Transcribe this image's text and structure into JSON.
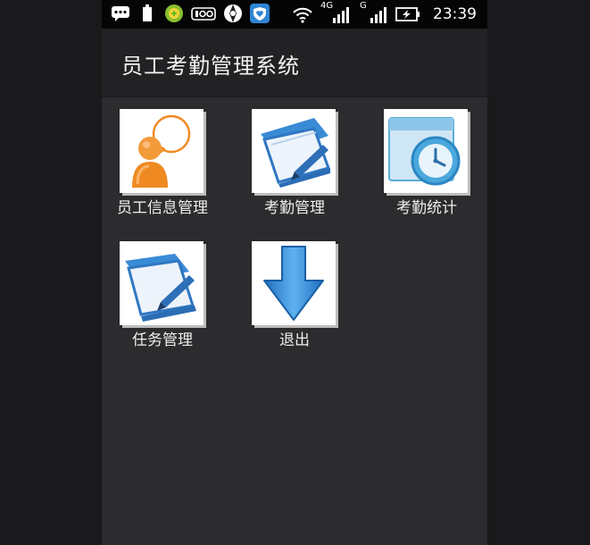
{
  "status_bar": {
    "time": "23:39",
    "network_labels": [
      "4G",
      "G"
    ],
    "icons": [
      "message-icon",
      "battery-small-icon",
      "game-icon",
      "data-counter-icon",
      "aperture-icon",
      "shield-heart-icon",
      "wifi-icon",
      "signal-4g-icon",
      "signal-g-icon",
      "battery-charging-icon"
    ]
  },
  "app": {
    "title": "员工考勤管理系统"
  },
  "menu": {
    "items": [
      {
        "label": "员工信息管理",
        "icon": "employee-chat-icon"
      },
      {
        "label": "考勤管理",
        "icon": "notepad-pen-icon"
      },
      {
        "label": "考勤统计",
        "icon": "window-clock-icon"
      },
      {
        "label": "任务管理",
        "icon": "folder-pen-icon"
      },
      {
        "label": "退出",
        "icon": "arrow-down-icon"
      }
    ]
  },
  "colors": {
    "background": "#2c2b2e",
    "app_bar": "#222124",
    "status_bar": "#050505",
    "icon_blue": "#2e86d4",
    "icon_orange": "#f08a24"
  }
}
